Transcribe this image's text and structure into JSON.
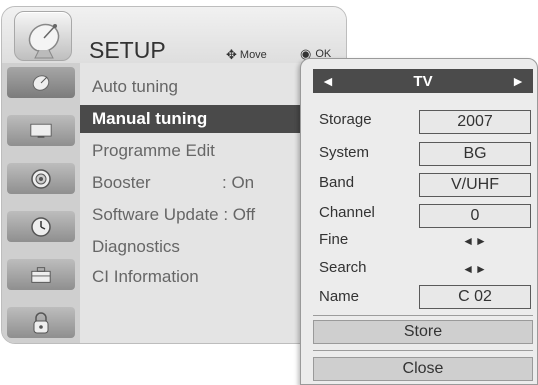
{
  "header": {
    "title": "SETUP",
    "help_move_label": "Move",
    "help_ok_label": "OK"
  },
  "categories": [
    {
      "icon": "satellite-dish-icon",
      "active": true
    },
    {
      "icon": "monitor-icon",
      "active": false
    },
    {
      "icon": "speaker-icon",
      "active": false
    },
    {
      "icon": "clock-icon",
      "active": false
    },
    {
      "icon": "toolbox-icon",
      "active": false
    },
    {
      "icon": "lock-icon",
      "active": false
    }
  ],
  "menu": {
    "items": [
      {
        "label": "Auto tuning",
        "value": ""
      },
      {
        "label": "Manual tuning",
        "value": "",
        "selected": true
      },
      {
        "label": "Programme Edit",
        "value": ""
      },
      {
        "label": "Booster",
        "value": ": On"
      },
      {
        "label": "Software Update : Off",
        "value": ""
      },
      {
        "label": "Diagnostics",
        "value": ""
      },
      {
        "label": "CI Information",
        "value": ""
      }
    ]
  },
  "manual_tuning": {
    "source": "TV",
    "fields": {
      "storage": {
        "label": "Storage",
        "value": "2007"
      },
      "system": {
        "label": "System",
        "value": "BG"
      },
      "band": {
        "label": "Band",
        "value": "V/UHF"
      },
      "channel": {
        "label": "Channel",
        "value": "0"
      },
      "fine": {
        "label": "Fine",
        "value": "◄►"
      },
      "search": {
        "label": "Search",
        "value": "◄►"
      },
      "name": {
        "label": "Name",
        "value": "C  02"
      }
    },
    "store_label": "Store",
    "close_label": "Close"
  },
  "colors": {
    "selection": "#4a4a4a",
    "panel_bg": "#e4e4e4",
    "dialog_bg": "#ececec"
  }
}
